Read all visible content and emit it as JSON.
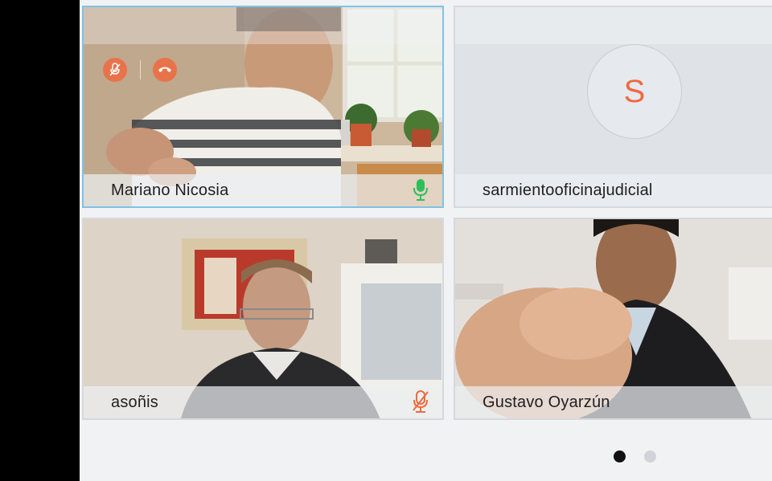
{
  "participants": [
    {
      "name": "Mariano Nicosia",
      "mic": "active",
      "speaking": true
    },
    {
      "name": "sarmientooficinajudicial",
      "avatar_letter": "S"
    },
    {
      "name": "asoñis",
      "mic": "muted"
    },
    {
      "name": "Gustavo Oyarzún"
    }
  ],
  "pagination": {
    "pages": 2,
    "current": 1
  },
  "colors": {
    "accent_orange": "#ee6a3e",
    "active_border": "#7fc3e6",
    "mic_active": "#2fbf5a",
    "stage_bg": "#f1f2f4"
  }
}
